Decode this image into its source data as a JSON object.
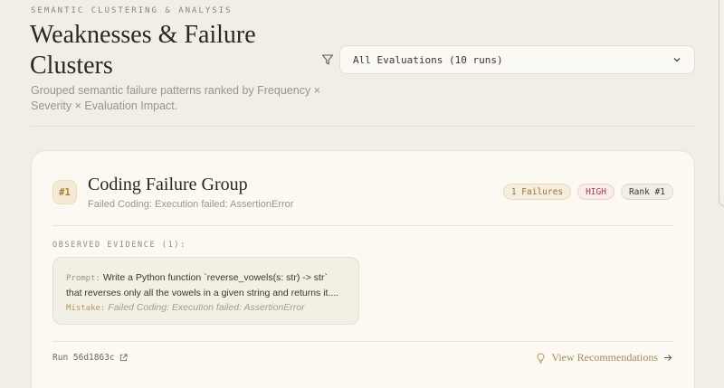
{
  "header": {
    "eyebrow": "SEMANTIC CLUSTERING & ANALYSIS",
    "title": "Weaknesses & Failure Clusters",
    "subtitle": "Grouped semantic failure patterns ranked by Frequency × Severity × Evaluation Impact."
  },
  "filter": {
    "icon": "filter-icon",
    "selected": "All Evaluations (10 runs)"
  },
  "cluster": {
    "rank_badge": "#1",
    "title": "Coding Failure Group",
    "subtitle": "Failed Coding: Execution failed: AssertionError",
    "pills": {
      "failures": "1 Failures",
      "severity": "HIGH",
      "rank": "Rank #1"
    },
    "evidence_label": "OBSERVED EVIDENCE (1):",
    "evidence": {
      "prompt_key": "Prompt:",
      "prompt_text": "Write a Python function `reverse_vowels(s: str) -> str` that reverses only all the vowels in a given string and returns it....",
      "mistake_key": "Mistake:",
      "mistake_text": "Failed Coding: Execution failed: AssertionError"
    },
    "run_label": "Run 56d1863c",
    "recommendations_label": "View Recommendations"
  },
  "colors": {
    "background": "#f1eee5",
    "card": "#fbf9f2",
    "accent_gold": "#a87c3a",
    "severity_red": "#a3424a"
  }
}
